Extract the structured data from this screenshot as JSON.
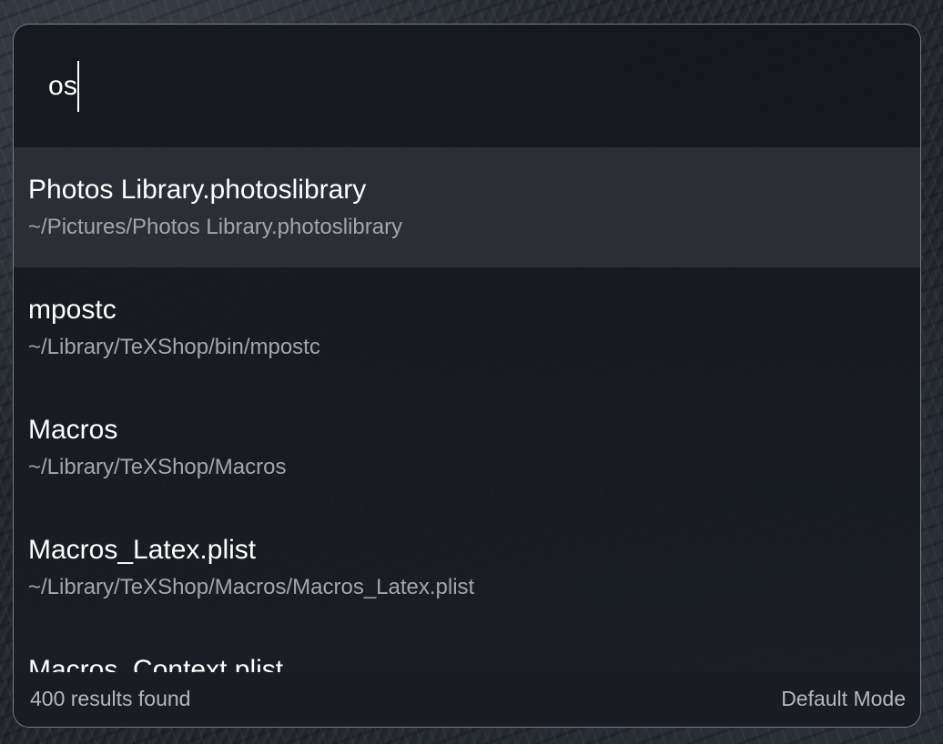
{
  "search": {
    "query": "os"
  },
  "results": [
    {
      "title": "Photos Library.photoslibrary",
      "path": "~/Pictures/Photos Library.photoslibrary",
      "selected": true
    },
    {
      "title": "mpostc",
      "path": "~/Library/TeXShop/bin/mpostc",
      "selected": false
    },
    {
      "title": "Macros",
      "path": "~/Library/TeXShop/Macros",
      "selected": false
    },
    {
      "title": "Macros_Latex.plist",
      "path": "~/Library/TeXShop/Macros/Macros_Latex.plist",
      "selected": false
    },
    {
      "title": "Macros_Context.plist",
      "path": "",
      "selected": false
    }
  ],
  "footer": {
    "count_label": "400 results found",
    "mode_label": "Default Mode"
  }
}
